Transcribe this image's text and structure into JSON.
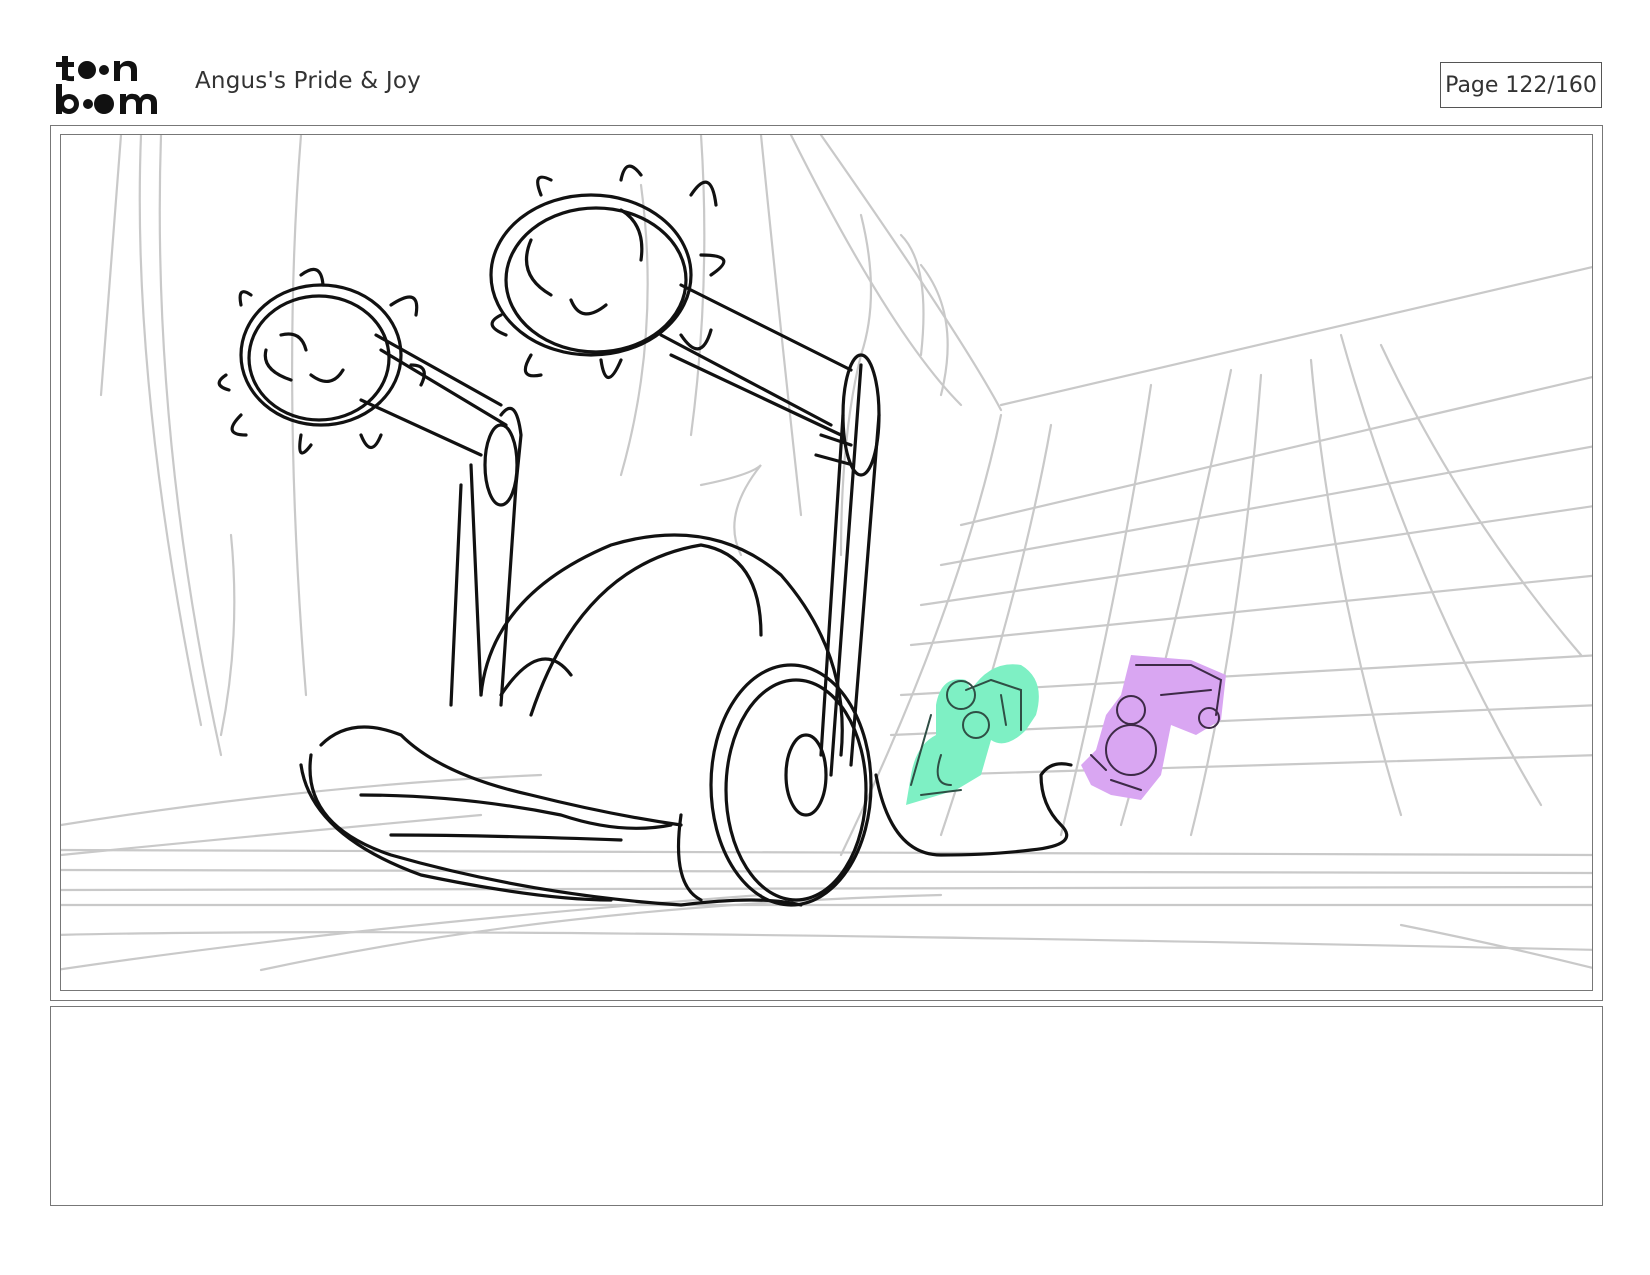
{
  "header": {
    "logo_text": "toon boom",
    "project_title": "Angus's Pride & Joy",
    "page_label": "Page 122/160"
  },
  "panel": {
    "colors": {
      "ink": "#111111",
      "background_sketch": "#c9c9c9",
      "green_figure": "#7ef0c4",
      "purple_figure": "#d9a6f2"
    }
  },
  "notes": {
    "dialogue": ""
  }
}
